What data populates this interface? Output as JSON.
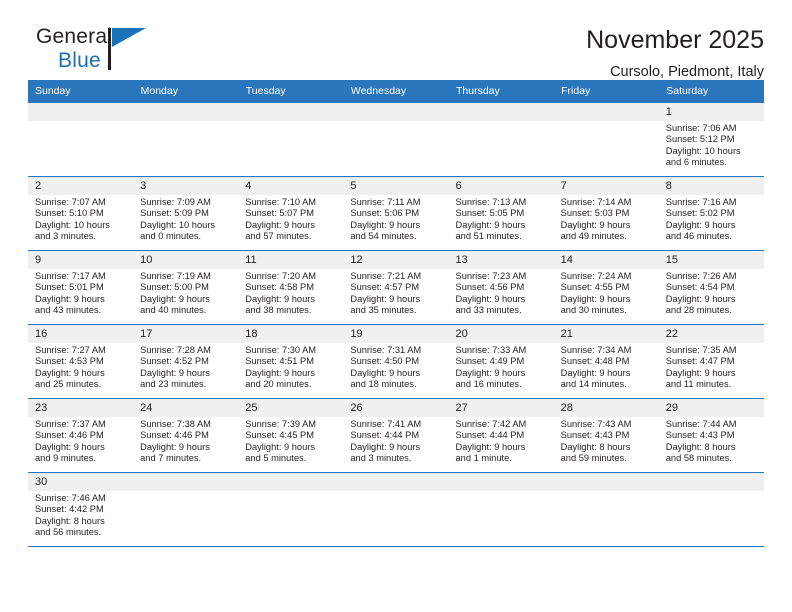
{
  "brand": {
    "name_part1": "General",
    "name_part2": "Blue",
    "logo_icon": "blue-flag-icon"
  },
  "header": {
    "title": "November 2025",
    "subtitle": "Cursolo, Piedmont, Italy"
  },
  "theme": {
    "accent": "#2a76bc",
    "daynum_bg": "#f0f0f0",
    "text": "#231f20",
    "brand_blue": "#1f6fb5"
  },
  "labels": {
    "sunrise": "Sunrise:",
    "sunset": "Sunset:",
    "daylight": "Daylight:"
  },
  "weekdays": [
    "Sunday",
    "Monday",
    "Tuesday",
    "Wednesday",
    "Thursday",
    "Friday",
    "Saturday"
  ],
  "weeks": [
    [
      {
        "blank": true
      },
      {
        "blank": true
      },
      {
        "blank": true
      },
      {
        "blank": true
      },
      {
        "blank": true
      },
      {
        "blank": true
      },
      {
        "day": "1",
        "sunrise": "Sunrise: 7:06 AM",
        "sunset": "Sunset: 5:12 PM",
        "daylight_1": "Daylight: 10 hours",
        "daylight_2": "and 6 minutes."
      }
    ],
    [
      {
        "day": "2",
        "sunrise": "Sunrise: 7:07 AM",
        "sunset": "Sunset: 5:10 PM",
        "daylight_1": "Daylight: 10 hours",
        "daylight_2": "and 3 minutes."
      },
      {
        "day": "3",
        "sunrise": "Sunrise: 7:09 AM",
        "sunset": "Sunset: 5:09 PM",
        "daylight_1": "Daylight: 10 hours",
        "daylight_2": "and 0 minutes."
      },
      {
        "day": "4",
        "sunrise": "Sunrise: 7:10 AM",
        "sunset": "Sunset: 5:07 PM",
        "daylight_1": "Daylight: 9 hours",
        "daylight_2": "and 57 minutes."
      },
      {
        "day": "5",
        "sunrise": "Sunrise: 7:11 AM",
        "sunset": "Sunset: 5:06 PM",
        "daylight_1": "Daylight: 9 hours",
        "daylight_2": "and 54 minutes."
      },
      {
        "day": "6",
        "sunrise": "Sunrise: 7:13 AM",
        "sunset": "Sunset: 5:05 PM",
        "daylight_1": "Daylight: 9 hours",
        "daylight_2": "and 51 minutes."
      },
      {
        "day": "7",
        "sunrise": "Sunrise: 7:14 AM",
        "sunset": "Sunset: 5:03 PM",
        "daylight_1": "Daylight: 9 hours",
        "daylight_2": "and 49 minutes."
      },
      {
        "day": "8",
        "sunrise": "Sunrise: 7:16 AM",
        "sunset": "Sunset: 5:02 PM",
        "daylight_1": "Daylight: 9 hours",
        "daylight_2": "and 46 minutes."
      }
    ],
    [
      {
        "day": "9",
        "sunrise": "Sunrise: 7:17 AM",
        "sunset": "Sunset: 5:01 PM",
        "daylight_1": "Daylight: 9 hours",
        "daylight_2": "and 43 minutes."
      },
      {
        "day": "10",
        "sunrise": "Sunrise: 7:19 AM",
        "sunset": "Sunset: 5:00 PM",
        "daylight_1": "Daylight: 9 hours",
        "daylight_2": "and 40 minutes."
      },
      {
        "day": "11",
        "sunrise": "Sunrise: 7:20 AM",
        "sunset": "Sunset: 4:58 PM",
        "daylight_1": "Daylight: 9 hours",
        "daylight_2": "and 38 minutes."
      },
      {
        "day": "12",
        "sunrise": "Sunrise: 7:21 AM",
        "sunset": "Sunset: 4:57 PM",
        "daylight_1": "Daylight: 9 hours",
        "daylight_2": "and 35 minutes."
      },
      {
        "day": "13",
        "sunrise": "Sunrise: 7:23 AM",
        "sunset": "Sunset: 4:56 PM",
        "daylight_1": "Daylight: 9 hours",
        "daylight_2": "and 33 minutes."
      },
      {
        "day": "14",
        "sunrise": "Sunrise: 7:24 AM",
        "sunset": "Sunset: 4:55 PM",
        "daylight_1": "Daylight: 9 hours",
        "daylight_2": "and 30 minutes."
      },
      {
        "day": "15",
        "sunrise": "Sunrise: 7:26 AM",
        "sunset": "Sunset: 4:54 PM",
        "daylight_1": "Daylight: 9 hours",
        "daylight_2": "and 28 minutes."
      }
    ],
    [
      {
        "day": "16",
        "sunrise": "Sunrise: 7:27 AM",
        "sunset": "Sunset: 4:53 PM",
        "daylight_1": "Daylight: 9 hours",
        "daylight_2": "and 25 minutes."
      },
      {
        "day": "17",
        "sunrise": "Sunrise: 7:28 AM",
        "sunset": "Sunset: 4:52 PM",
        "daylight_1": "Daylight: 9 hours",
        "daylight_2": "and 23 minutes."
      },
      {
        "day": "18",
        "sunrise": "Sunrise: 7:30 AM",
        "sunset": "Sunset: 4:51 PM",
        "daylight_1": "Daylight: 9 hours",
        "daylight_2": "and 20 minutes."
      },
      {
        "day": "19",
        "sunrise": "Sunrise: 7:31 AM",
        "sunset": "Sunset: 4:50 PM",
        "daylight_1": "Daylight: 9 hours",
        "daylight_2": "and 18 minutes."
      },
      {
        "day": "20",
        "sunrise": "Sunrise: 7:33 AM",
        "sunset": "Sunset: 4:49 PM",
        "daylight_1": "Daylight: 9 hours",
        "daylight_2": "and 16 minutes."
      },
      {
        "day": "21",
        "sunrise": "Sunrise: 7:34 AM",
        "sunset": "Sunset: 4:48 PM",
        "daylight_1": "Daylight: 9 hours",
        "daylight_2": "and 14 minutes."
      },
      {
        "day": "22",
        "sunrise": "Sunrise: 7:35 AM",
        "sunset": "Sunset: 4:47 PM",
        "daylight_1": "Daylight: 9 hours",
        "daylight_2": "and 11 minutes."
      }
    ],
    [
      {
        "day": "23",
        "sunrise": "Sunrise: 7:37 AM",
        "sunset": "Sunset: 4:46 PM",
        "daylight_1": "Daylight: 9 hours",
        "daylight_2": "and 9 minutes."
      },
      {
        "day": "24",
        "sunrise": "Sunrise: 7:38 AM",
        "sunset": "Sunset: 4:46 PM",
        "daylight_1": "Daylight: 9 hours",
        "daylight_2": "and 7 minutes."
      },
      {
        "day": "25",
        "sunrise": "Sunrise: 7:39 AM",
        "sunset": "Sunset: 4:45 PM",
        "daylight_1": "Daylight: 9 hours",
        "daylight_2": "and 5 minutes."
      },
      {
        "day": "26",
        "sunrise": "Sunrise: 7:41 AM",
        "sunset": "Sunset: 4:44 PM",
        "daylight_1": "Daylight: 9 hours",
        "daylight_2": "and 3 minutes."
      },
      {
        "day": "27",
        "sunrise": "Sunrise: 7:42 AM",
        "sunset": "Sunset: 4:44 PM",
        "daylight_1": "Daylight: 9 hours",
        "daylight_2": "and 1 minute."
      },
      {
        "day": "28",
        "sunrise": "Sunrise: 7:43 AM",
        "sunset": "Sunset: 4:43 PM",
        "daylight_1": "Daylight: 8 hours",
        "daylight_2": "and 59 minutes."
      },
      {
        "day": "29",
        "sunrise": "Sunrise: 7:44 AM",
        "sunset": "Sunset: 4:43 PM",
        "daylight_1": "Daylight: 8 hours",
        "daylight_2": "and 58 minutes."
      }
    ],
    [
      {
        "day": "30",
        "sunrise": "Sunrise: 7:46 AM",
        "sunset": "Sunset: 4:42 PM",
        "daylight_1": "Daylight: 8 hours",
        "daylight_2": "and 56 minutes."
      },
      {
        "blank": true
      },
      {
        "blank": true
      },
      {
        "blank": true
      },
      {
        "blank": true
      },
      {
        "blank": true
      },
      {
        "blank": true
      }
    ]
  ]
}
